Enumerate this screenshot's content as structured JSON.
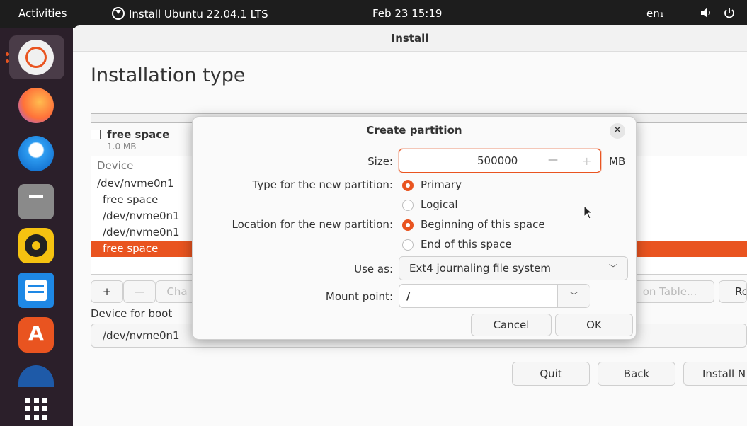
{
  "topbar": {
    "activities": "Activities",
    "app_title": "Install Ubuntu 22.04.1 LTS",
    "clock": "Feb 23 15:19",
    "input_method": "en₁",
    "volume_icon": "volume-icon",
    "power_icon": "power-icon"
  },
  "dock": {
    "items": [
      "ubuntu-installer",
      "firefox",
      "thunderbird",
      "files",
      "rhythmbox",
      "libreoffice-writer",
      "ubuntu-software",
      "help",
      "show-applications"
    ]
  },
  "window": {
    "title": "Install",
    "page_title": "Installation type",
    "selected_partition": {
      "label": "free space",
      "size": "1.0 MB"
    },
    "table": {
      "header": "Device",
      "rows": [
        "/dev/nvme0n1",
        "free space",
        "/dev/nvme0n1",
        "/dev/nvme0n1",
        "free space"
      ],
      "selected_index": 4
    },
    "partition_buttons": {
      "add": "+",
      "remove": "—",
      "change": "Cha",
      "new_table": "on Table...",
      "revert": "Re"
    },
    "boot_loader": {
      "label": "Device for boot",
      "value": "/dev/nvme0n1"
    },
    "nav": {
      "quit": "Quit",
      "back": "Back",
      "install_now": "Install N"
    }
  },
  "dialog": {
    "title": "Create partition",
    "size_label": "Size:",
    "size_value": "500000",
    "size_unit": "MB",
    "type_label": "Type for the new partition:",
    "type_options": [
      "Primary",
      "Logical"
    ],
    "type_selected": "Primary",
    "location_label": "Location for the new partition:",
    "location_options": [
      "Beginning of this space",
      "End of this space"
    ],
    "location_selected": "Beginning of this space",
    "use_as_label": "Use as:",
    "use_as_value": "Ext4 journaling file system",
    "mount_label": "Mount point:",
    "mount_value": "/",
    "cancel": "Cancel",
    "ok": "OK"
  },
  "colors": {
    "accent": "#e95420",
    "topbar": "#1d1d1d",
    "dock": "#2b1f2a"
  }
}
